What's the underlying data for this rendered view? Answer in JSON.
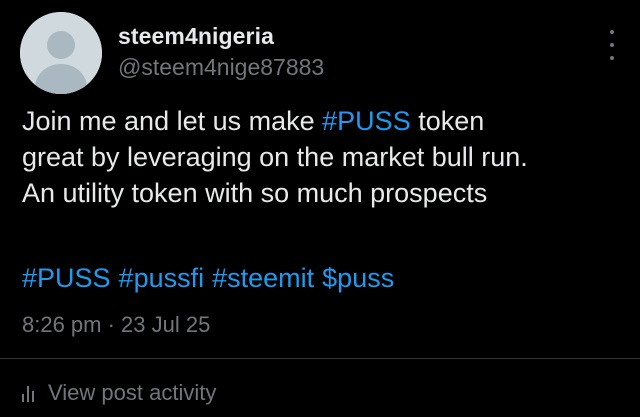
{
  "author": {
    "display_name": "steem4nigeria",
    "handle": "@steem4nige87883",
    "avatar_icon": "default-avatar-icon"
  },
  "post": {
    "text_lines": [
      {
        "before": "Join me and let us make ",
        "hashtag": "#PUSS",
        "after": " token"
      },
      {
        "text": "great by leveraging on the market bull run."
      },
      {
        "text": "An utility token with so much prospects"
      }
    ],
    "tags": [
      "#PUSS",
      "#pussfi",
      "#steemit",
      "$puss"
    ],
    "timestamp": "8:26 pm · 23 Jul 25"
  },
  "actions": {
    "more_icon": "more-vertical-icon",
    "view_activity_label": "View post activity",
    "view_activity_icon": "bar-chart-icon"
  },
  "colors": {
    "background": "#000000",
    "text": "#e7e9ea",
    "muted": "#71767b",
    "link": "#1d9bf0",
    "avatar_bg": "#cfd9de"
  }
}
